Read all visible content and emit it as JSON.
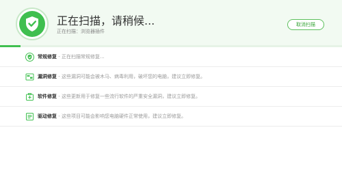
{
  "header": {
    "title": "正在扫描，请稍候...",
    "subtitle": "正在扫描：浏览器插件",
    "cancel_label": "取消扫描",
    "progress": 0.06
  },
  "colors": {
    "accent": "#3fbf4f",
    "header_bg": "#f2faf2"
  },
  "items": [
    {
      "icon": "shield-icon",
      "name": "常规修复",
      "separator": " - ",
      "desc": "正在扫描常规修复..."
    },
    {
      "icon": "patch-icon",
      "name": "漏洞修复",
      "separator": " - ",
      "desc": "这些漏洞可能会被木马、病毒利用，破坏您的电脑，建议立即修复。"
    },
    {
      "icon": "software-icon",
      "name": "软件修复",
      "separator": " - ",
      "desc": "这些更新用于修复一些流行软件的严重安全漏洞，建议立即修复。"
    },
    {
      "icon": "driver-icon",
      "name": "驱动修复",
      "separator": " - ",
      "desc": "这些项目可能会影响您电脑硬件正常使用，建议立即修复。"
    }
  ]
}
